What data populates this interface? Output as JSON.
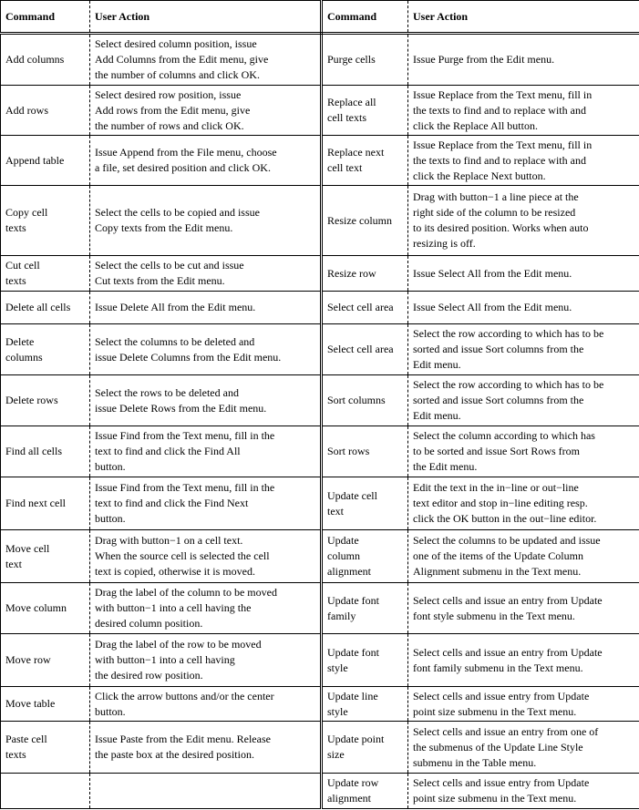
{
  "headers": [
    "Command",
    "User Action",
    "Command",
    "User Action"
  ],
  "rows": [
    {
      "lc": "Add columns",
      "la": "Select desired column position, issue\nAdd Columns from the Edit menu, give\nthe number of columns and click OK.",
      "rc": "Purge cells",
      "ra": "Issue Purge from the Edit menu."
    },
    {
      "lc": "Add rows",
      "la": "Select desired row position, issue\nAdd rows from the Edit menu, give\nthe number of rows and click OK.",
      "rc": "Replace all\ncell texts",
      "ra": "Issue Replace from the Text menu, fill in\nthe texts to find and to replace with and\nclick the Replace All button."
    },
    {
      "lc": "Append table",
      "la": "Issue Append from the File menu, choose\na file, set desired position and click OK.",
      "rc": "Replace next\ncell text",
      "ra": "Issue Replace from the Text menu, fill in\nthe texts to find and to replace with and\nclick the Replace Next button."
    },
    {
      "lc": "Copy cell\ntexts",
      "la": "Select the cells to be copied and issue\nCopy texts from the Edit menu.",
      "rc": "Resize column",
      "ra": "Drag with button−1 a line piece at the\nright side of the column to be resized\nto its desired position. Works when auto\nresizing is off."
    },
    {
      "lc": "Cut cell\ntexts",
      "la": "Select the cells to be cut and issue\nCut texts from the Edit menu.",
      "rc": "Resize row",
      "ra": "Issue Select All from the Edit menu."
    },
    {
      "lc": "Delete all cells",
      "la": "Issue Delete All from the Edit menu.",
      "rc": "Select cell area",
      "ra": "Issue Select All from the Edit menu."
    },
    {
      "lc": "Delete\ncolumns",
      "la": "Select the columns to be deleted and\nissue Delete Columns from the Edit menu.",
      "rc": "Select cell area",
      "ra": "Select the row according to which has to be\nsorted and issue Sort columns from the\nEdit menu."
    },
    {
      "lc": "Delete rows",
      "la": "Select the rows to be deleted and\nissue Delete Rows from the Edit menu.",
      "rc": "Sort columns",
      "ra": "Select the row according to which has to be\nsorted and issue Sort columns from the\nEdit menu."
    },
    {
      "lc": "Find all cells",
      "la": "Issue Find from the Text menu, fill in the\ntext to find and click the Find All\nbutton.",
      "rc": "Sort rows",
      "ra": "Select the column according to which has\nto be sorted and issue Sort Rows from\nthe Edit menu."
    },
    {
      "lc": "Find next cell",
      "la": "Issue Find from the Text menu, fill in the\ntext to find and click the Find Next\n button.",
      "rc": "Update cell\ntext",
      "ra": "Edit the text in the in−line or out−line\ntext editor and stop in−line editing resp.\nclick the OK button in the out−line editor."
    },
    {
      "lc": "Move cell\ntext",
      "la": "Drag with button−1 on a cell text.\nWhen the source cell is selected the cell\ntext is copied, otherwise it is moved.",
      "rc": "Update\ncolumn\nalignment",
      "ra": "Select the columns to be updated and issue\none of the items of the Update Column\nAlignment submenu in the Text menu."
    },
    {
      "lc": "Move column",
      "la": "Drag the label of the column to be moved\nwith button−1 into a cell having the\ndesired column position.",
      "rc": "Update font\nfamily",
      "ra": "Select cells and issue an entry from Update\nfont style submenu in the Text menu."
    },
    {
      "lc": "Move row",
      "la": "Drag the label of the row to be moved\nwith button−1 into a cell having\nthe desired row position.",
      "rc": "Update font\nstyle",
      "ra": "Select cells and issue an entry from Update\nfont family submenu in the Text menu."
    },
    {
      "lc": "Move table",
      "la": "Click the arrow buttons and/or the center\nbutton.",
      "rc": "Update line\nstyle",
      "ra": "Select cells and issue entry from Update\npoint size submenu in the Text menu."
    },
    {
      "lc": "Paste cell\ntexts",
      "la": "Issue Paste from the Edit menu. Release\nthe paste box at the desired position.",
      "rc": "Update point\n size",
      "ra": "Select cells and issue an entry from one of\nthe submenus of the Update Line Style\nsubmenu in the Table menu."
    },
    {
      "lc": "",
      "la": "",
      "rc": "Update row\nalignment",
      "ra": "Select cells and issue entry from Update\npoint size submenu in the Text menu."
    }
  ]
}
